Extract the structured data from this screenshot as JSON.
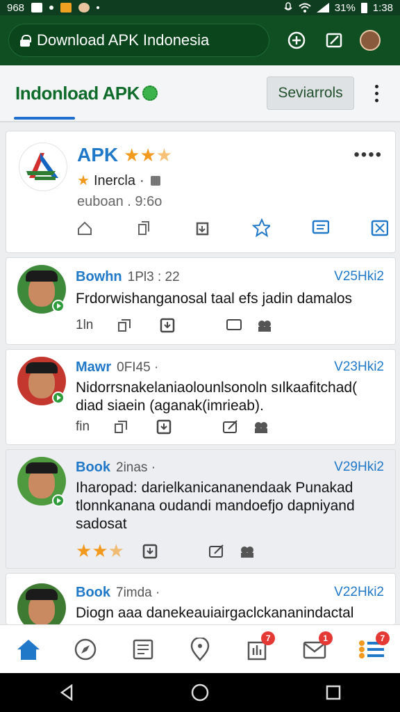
{
  "status_bar": {
    "left_text": "968",
    "battery_text": "31%",
    "time": "1:38"
  },
  "browser": {
    "url_text": "Download APK Indonesia"
  },
  "app_header": {
    "title": "Indonload APK",
    "services_label": "Seviarrols"
  },
  "featured": {
    "title": "APK",
    "rating": 2.5,
    "category": "Inercla",
    "separator": "·",
    "meta": "euboan . 9:6o"
  },
  "posts": [
    {
      "name": "Bowhn",
      "time": "1Pl3 : 22",
      "tag": "V25Hki2",
      "text": "Frdorwishanganosal taal efs jadin damalos",
      "count": "1ln",
      "rating": null
    },
    {
      "name": "Mawr",
      "time": "0FI45 ·",
      "tag": "V23Hki2",
      "text": "Nidorrsnakelaniaolounlsonoln sılkaafitchad( diad siaein (aganak(imrieab).",
      "count": "fin",
      "rating": null
    },
    {
      "name": "Book",
      "time": "2inas ·",
      "tag": "V29Hki2",
      "text": "Iharopad: darielkanicananendaak Punakad tlonnkanana oudandi mandoefjo dapniyand sadosat",
      "count": "",
      "rating": 2.5
    },
    {
      "name": "Book",
      "time": "7imda ·",
      "tag": "V22Hki2",
      "text": "Diogn aaa danekeauiairgaclckananindactal",
      "count": "",
      "rating": null
    }
  ],
  "bottom_nav": {
    "badges": [
      "7",
      "1",
      "7"
    ]
  },
  "colors": {
    "brand_green": "#0f4f22",
    "accent_blue": "#1f78c8",
    "star_orange": "#f39a1e",
    "badge_red": "#e53935"
  }
}
